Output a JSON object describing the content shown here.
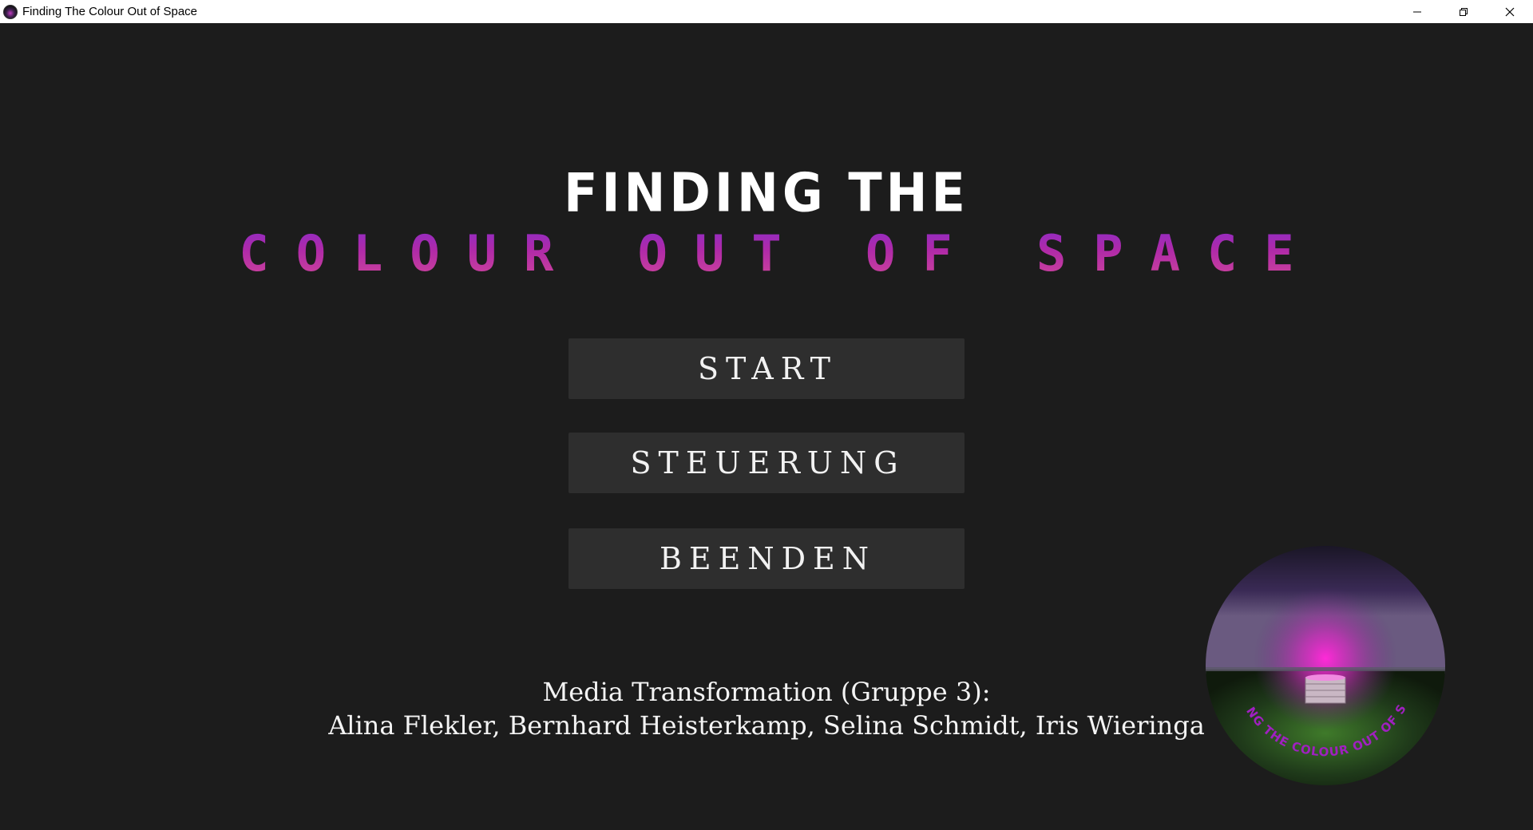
{
  "window": {
    "title": "Finding The Colour Out of Space",
    "controls": [
      "minimize",
      "restore",
      "close"
    ]
  },
  "game": {
    "title_line1": "FINDING THE",
    "title_line2": "COLOUR OUT OF SPACE",
    "menu": {
      "start": "START",
      "controls": "STEUERUNG",
      "quit": "BEENDEN"
    },
    "credits": {
      "line1": "Media Transformation (Gruppe 3):",
      "line2": "Alina Flekler, Bernhard Heisterkamp, Selina Schmidt, Iris Wieringa"
    },
    "logo_text": "FINDING THE COLOUR OUT OF SPACE"
  },
  "colors": {
    "background": "#1c1c1c",
    "button": "#2e2e2e",
    "accent_purple": "#9b2cc4",
    "accent_magenta": "#e040c8"
  }
}
